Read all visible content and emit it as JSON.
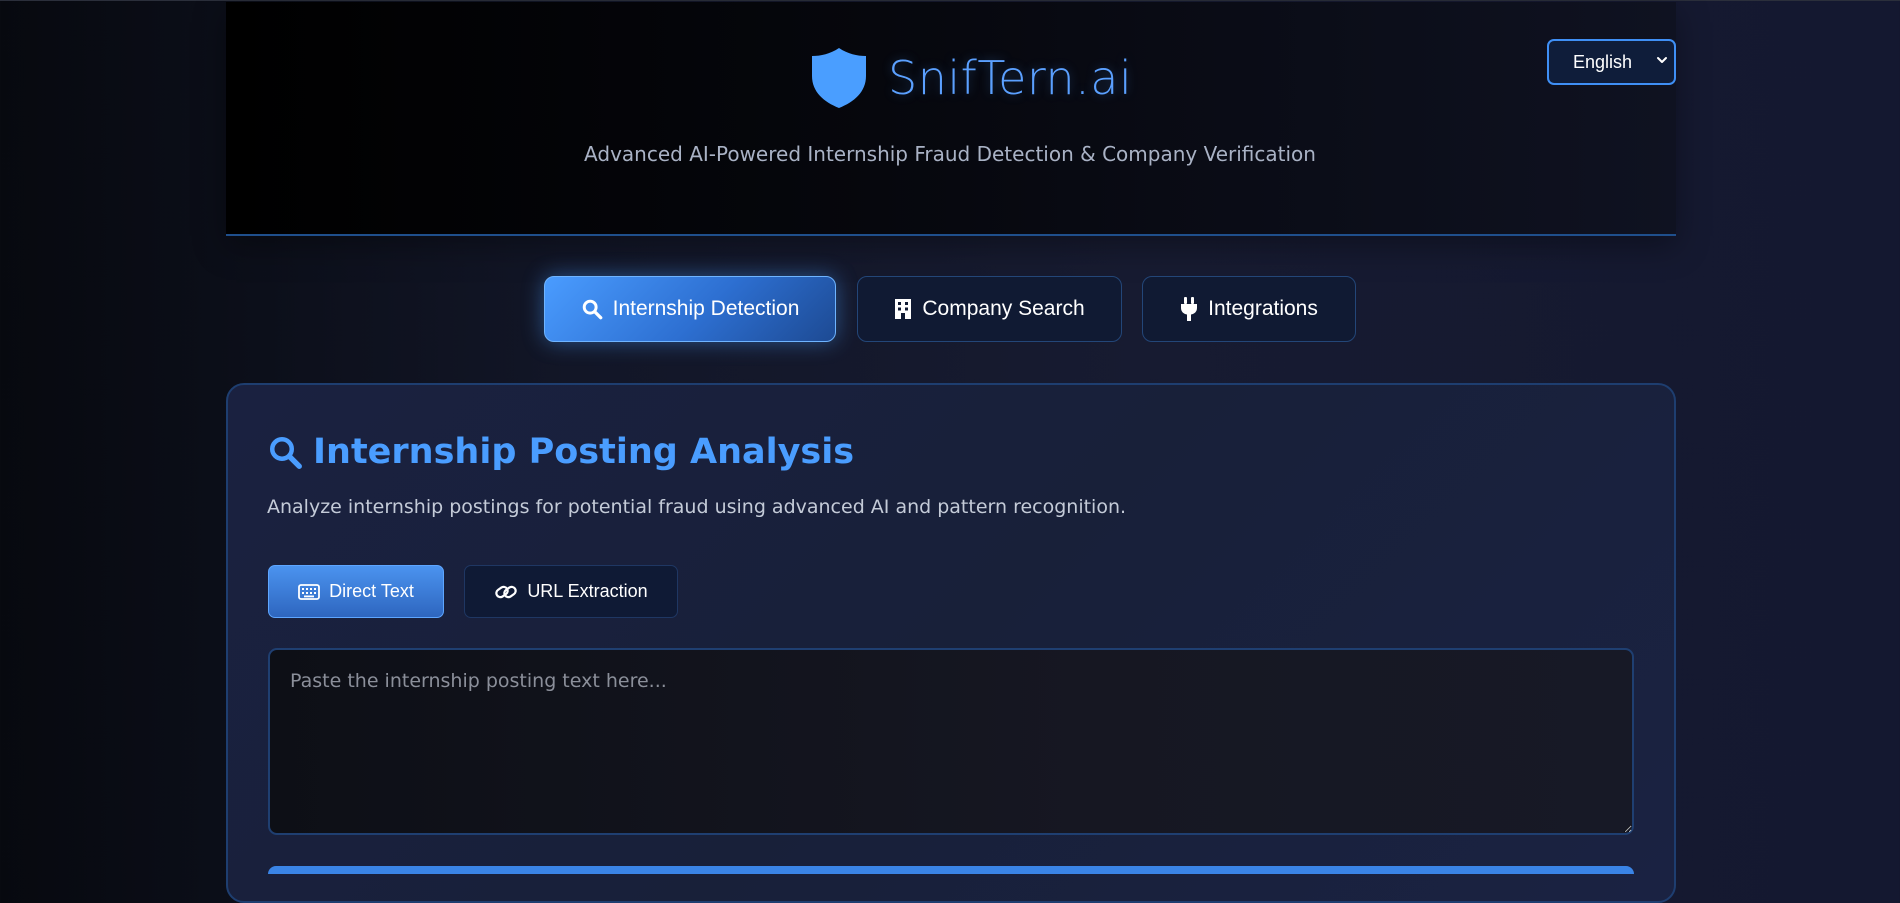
{
  "header": {
    "brand_name": "SnifTern.ai",
    "tagline": "Advanced AI-Powered Internship Fraud Detection & Company Verification",
    "language": {
      "selected": "English"
    }
  },
  "tabs": [
    {
      "label": "Internship Detection",
      "icon": "search-icon",
      "active": true
    },
    {
      "label": "Company Search",
      "icon": "building-icon",
      "active": false
    },
    {
      "label": "Integrations",
      "icon": "plug-icon",
      "active": false
    }
  ],
  "panel": {
    "title": "Internship Posting Analysis",
    "description": "Analyze internship postings for potential fraud using advanced AI and pattern recognition.",
    "modes": [
      {
        "label": "Direct Text",
        "icon": "keyboard-icon",
        "active": true
      },
      {
        "label": "URL Extraction",
        "icon": "link-icon",
        "active": false
      }
    ],
    "input": {
      "placeholder": "Paste the internship posting text here...",
      "value": ""
    }
  },
  "colors": {
    "accent": "#4a9eff",
    "background": "#151a2e",
    "panel_border": "#1e3e70"
  }
}
